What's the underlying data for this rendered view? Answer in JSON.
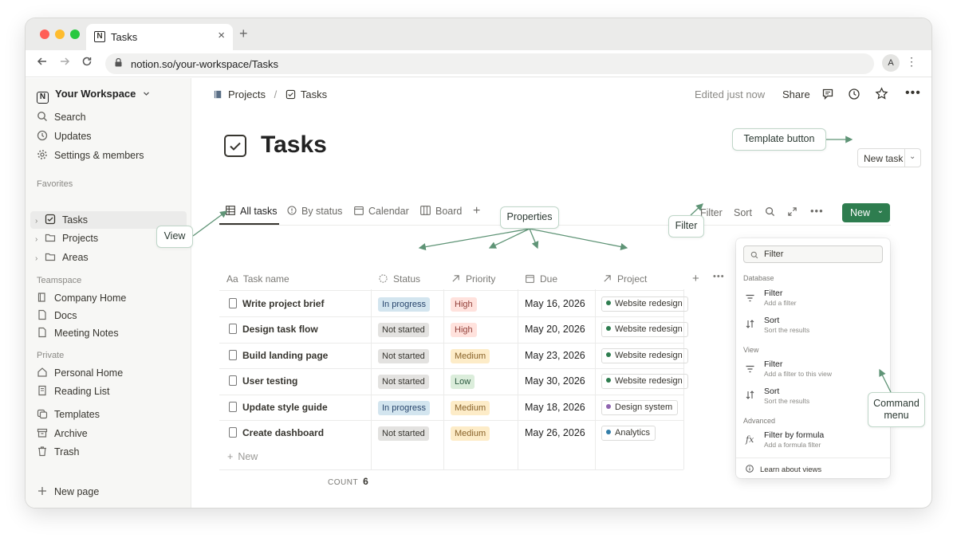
{
  "browser": {
    "tab_title": "Tasks",
    "close_glyph": "×",
    "new_tab_glyph": "+",
    "url": "notion.so/your-workspace/Tasks",
    "avatar_letter": "A",
    "tab_icon_letter": "N"
  },
  "sidebar": {
    "workspace_name": "Your Workspace",
    "top_items": [
      {
        "label": "Search",
        "icon": "search-icon"
      },
      {
        "label": "Updates",
        "icon": "clock-icon"
      },
      {
        "label": "Settings & members",
        "icon": "gear-icon"
      }
    ],
    "favorites_label": "Favorites",
    "favorites": [
      {
        "label": "Tasks",
        "icon": "checkbox-icon"
      },
      {
        "label": "Projects",
        "icon": "folder-icon"
      },
      {
        "label": "Areas",
        "icon": "folder-icon"
      }
    ],
    "teamspace_label": "Teamspace",
    "teamspace": [
      {
        "label": "Company Home",
        "icon": "book-icon"
      },
      {
        "label": "Docs",
        "icon": "page-icon"
      },
      {
        "label": "Meeting Notes",
        "icon": "page-icon"
      }
    ],
    "private_label": "Private",
    "private": [
      {
        "label": "Personal Home",
        "icon": "home-icon"
      },
      {
        "label": "Reading List",
        "icon": "page-icon"
      }
    ],
    "bottom_items": [
      {
        "label": "Templates",
        "icon": "templates-icon"
      },
      {
        "label": "Archive",
        "icon": "archive-icon"
      },
      {
        "label": "Trash",
        "icon": "trash-icon"
      }
    ],
    "new_page": "New page"
  },
  "header": {
    "breadcrumb_parent": "Projects",
    "breadcrumb_sep": "/",
    "breadcrumb_current": "Tasks",
    "edited": "Edited just now",
    "share": "Share"
  },
  "page": {
    "title": "Tasks",
    "new_task_button": "New task"
  },
  "views": {
    "tabs": [
      "All tasks",
      "By status",
      "Calendar",
      "Board"
    ],
    "filter": "Filter",
    "sort": "Sort",
    "new_button": "New"
  },
  "table": {
    "columns": [
      "Task name",
      "Status",
      "Priority",
      "Due",
      "Project"
    ],
    "column_prefix": "Aa",
    "rows": [
      {
        "name": "Write project brief",
        "status": "In progress",
        "priority": "High",
        "due": "May 16, 2026",
        "project": "Website redesign"
      },
      {
        "name": "Design task flow",
        "status": "Not started",
        "priority": "High",
        "due": "May 20, 2026",
        "project": "Website redesign"
      },
      {
        "name": "Build landing page",
        "status": "Not started",
        "priority": "Medium",
        "due": "May 23, 2026",
        "project": "Website redesign"
      },
      {
        "name": "User testing",
        "status": "Not started",
        "priority": "Low",
        "due": "May 30, 2026",
        "project": "Website redesign"
      },
      {
        "name": "Update style guide",
        "status": "In progress",
        "priority": "Medium",
        "due": "May 18, 2026",
        "project": "Design system"
      },
      {
        "name": "Create dashboard",
        "status": "Not started",
        "priority": "Medium",
        "due": "May 26, 2026",
        "project": "Analytics"
      }
    ],
    "new_row": "New",
    "count_label": "COUNT",
    "count_value": "6"
  },
  "command_menu": {
    "search_value": "Filter",
    "database_label": "Database",
    "database_items": [
      {
        "title": "Filter",
        "sub": "Add a filter"
      },
      {
        "title": "Sort",
        "sub": "Sort the results"
      }
    ],
    "view_label": "View",
    "view_items": [
      {
        "title": "Filter",
        "sub": "Add a filter to this view"
      },
      {
        "title": "Sort",
        "sub": "Sort the results"
      }
    ],
    "advanced_label": "Advanced",
    "advanced_items": [
      {
        "title": "Filter by formula",
        "sub": "Add a formula filter"
      }
    ],
    "learn": "Learn about views"
  },
  "callouts": {
    "template_button": "Template button",
    "view": "View",
    "properties": "Properties",
    "filter": "Filter",
    "command_menu_line1": "Command",
    "command_menu_line2": "menu"
  },
  "colors": {
    "accent_green": "#2e7d4f",
    "callout_arrow": "#5f9476",
    "status_in_progress_bg": "#d3e5ef",
    "status_not_started_bg": "#e3e2e0",
    "priority_high_bg": "#ffe2dd",
    "priority_medium_bg": "#fdecc8",
    "priority_low_bg": "#dbeddb",
    "project_website": "#2e7d4f",
    "project_design": "#9065b0",
    "project_analytics": "#337ea9"
  }
}
